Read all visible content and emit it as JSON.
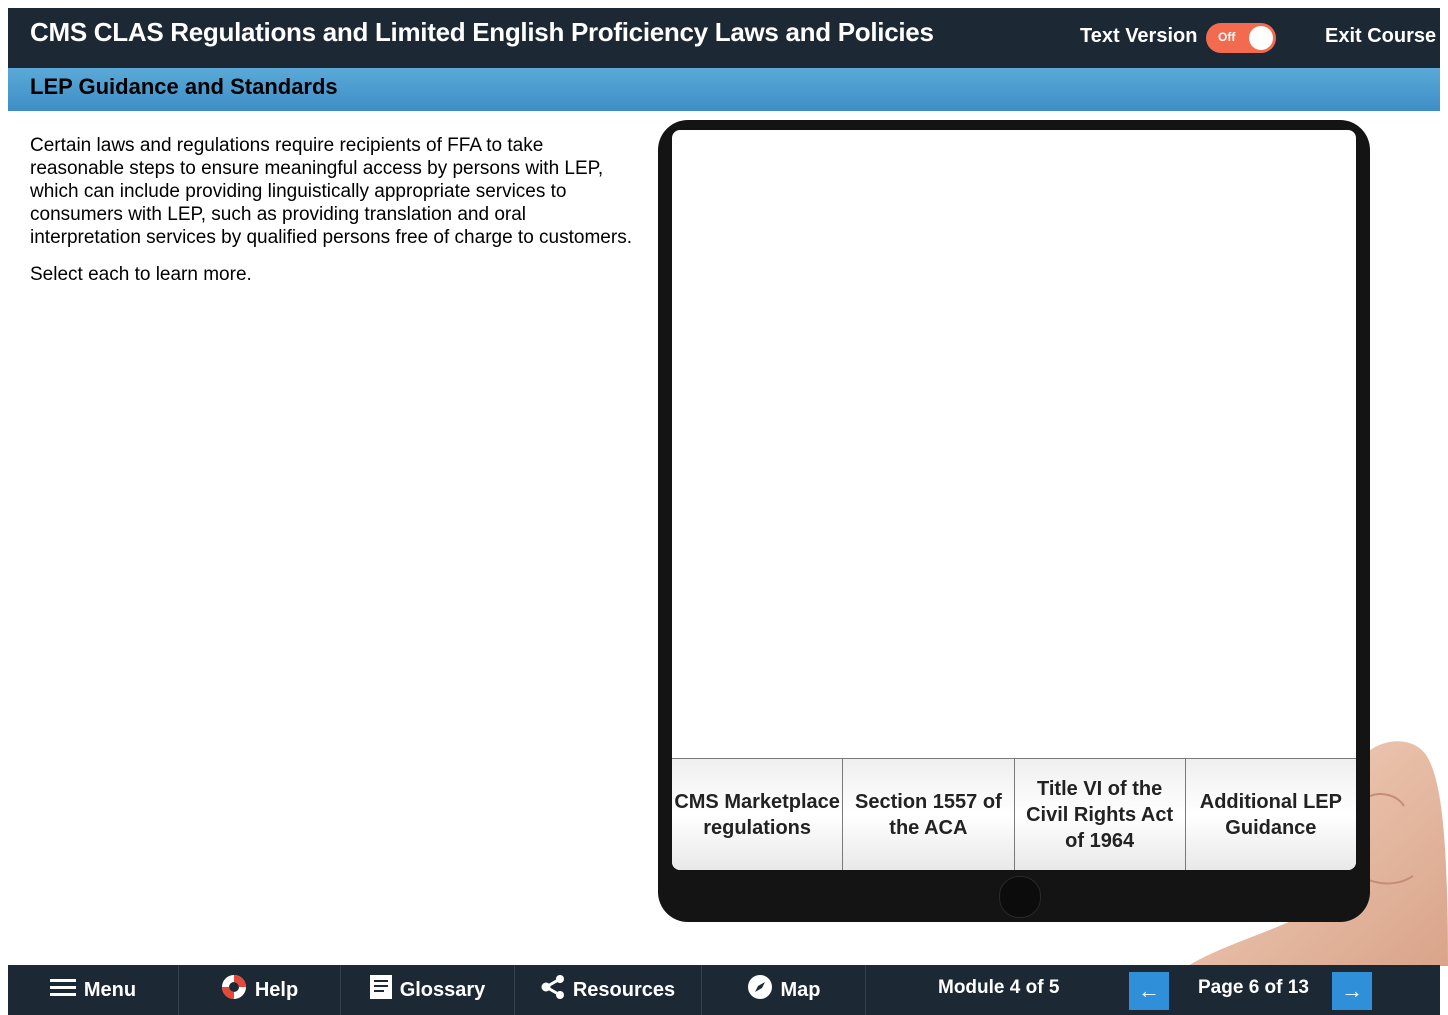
{
  "header": {
    "title": "CMS CLAS Regulations and Limited English Proficiency Laws and Policies",
    "text_version_label": "Text Version",
    "toggle_state": "Off",
    "exit_label": "Exit Course"
  },
  "subheader": {
    "title": "LEP Guidance and Standards"
  },
  "content": {
    "paragraph": "Certain laws and regulations require recipients of FFA to take reasonable steps to ensure meaningful access by persons with LEP, which can include providing linguistically appropriate services to consumers with LEP, such as providing translation and oral interpretation services by qualified persons free of charge to customers.",
    "instruction": "Select each to learn more."
  },
  "tablet": {
    "buttons": [
      "CMS Marketplace regulations",
      "Section 1557 of the ACA",
      "Title VI of the Civil Rights Act of 1964",
      "Additional LEP Guidance"
    ]
  },
  "footer": {
    "menu": "Menu",
    "help": "Help",
    "glossary": "Glossary",
    "resources": "Resources",
    "map": "Map",
    "module": "Module 4 of 5",
    "page": "Page 6 of 13",
    "prev_icon": "←",
    "next_icon": "→"
  },
  "colors": {
    "header_bg": "#1c2833",
    "subheader_bg": "#4a9ccf",
    "toggle_off": "#f26b4f",
    "nav_button": "#2f8fd8"
  },
  "icons": [
    "hamburger-icon",
    "lifebuoy-icon",
    "book-icon",
    "share-icon",
    "compass-icon",
    "arrow-left-icon",
    "arrow-right-icon"
  ]
}
